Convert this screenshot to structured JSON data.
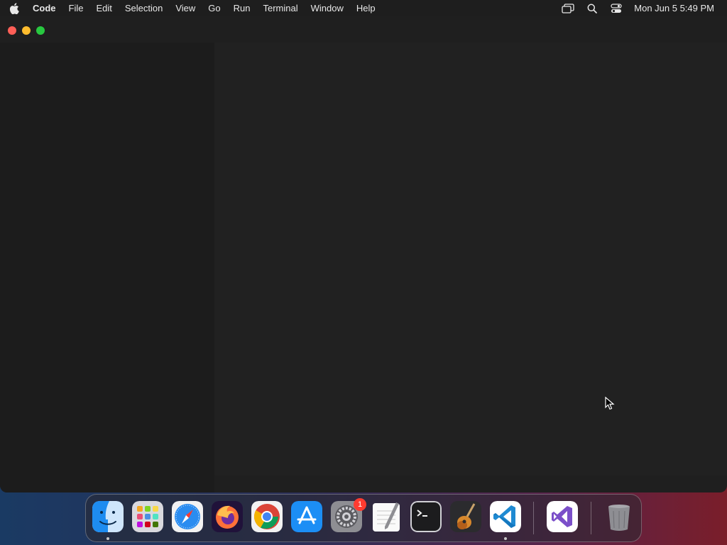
{
  "menubar": {
    "apple_icon": "apple-logo-icon",
    "app_name": "Code",
    "menus": [
      "File",
      "Edit",
      "Selection",
      "View",
      "Go",
      "Run",
      "Terminal",
      "Window",
      "Help"
    ],
    "status_icons": [
      "screen-mirroring-icon",
      "spotlight-search-icon",
      "control-center-icon"
    ],
    "clock": "Mon Jun 5  5:49 PM"
  },
  "window": {
    "app": "Visual Studio Code",
    "controls": [
      "close",
      "minimize",
      "zoom"
    ]
  },
  "dock": {
    "items": [
      {
        "name": "Finder",
        "icon": "finder-icon",
        "running": true
      },
      {
        "name": "Launchpad",
        "icon": "launchpad-icon",
        "running": false
      },
      {
        "name": "Safari",
        "icon": "safari-icon",
        "running": false
      },
      {
        "name": "Firefox",
        "icon": "firefox-icon",
        "running": false
      },
      {
        "name": "Google Chrome",
        "icon": "chrome-icon",
        "running": false
      },
      {
        "name": "App Store",
        "icon": "app-store-icon",
        "running": false
      },
      {
        "name": "System Preferences",
        "icon": "system-preferences-icon",
        "running": false,
        "badge": "1"
      },
      {
        "name": "TextEdit",
        "icon": "textedit-icon",
        "running": false
      },
      {
        "name": "Terminal",
        "icon": "terminal-icon",
        "running": false
      },
      {
        "name": "GarageBand",
        "icon": "garageband-icon",
        "running": false
      },
      {
        "name": "Visual Studio Code",
        "icon": "vscode-icon",
        "running": true
      },
      {
        "name": "Visual Studio",
        "icon": "visual-studio-icon",
        "running": false
      },
      {
        "name": "Trash",
        "icon": "trash-icon",
        "running": false
      }
    ]
  },
  "colors": {
    "menubar_bg": "#1e1e1e",
    "window_bg": "#1f1f1f",
    "editor_bg": "#212121",
    "close": "#ff5f57",
    "minimize": "#febc2e",
    "zoom": "#28c840",
    "badge": "#ff3b30"
  }
}
